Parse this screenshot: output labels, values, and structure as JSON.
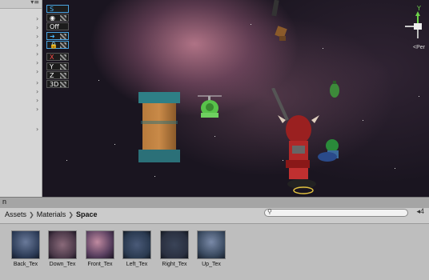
{
  "toolbar_buttons": [
    {
      "label": "S"
    },
    {
      "label": "◉"
    },
    {
      "label": "Off"
    },
    {
      "label": "➜"
    },
    {
      "label": "🔒"
    },
    {
      "label": "X"
    },
    {
      "label": "Y"
    },
    {
      "label": "Z"
    },
    {
      "label": "3D"
    }
  ],
  "gizmo": {
    "y_label": "Y",
    "persp_label": "<Per"
  },
  "project": {
    "tab_label": "n",
    "breadcrumb": [
      "Assets",
      "Materials",
      "Space"
    ],
    "search_placeholder": ""
  },
  "assets": [
    {
      "name": "Back_Tex",
      "color": "#2b3a55"
    },
    {
      "name": "Down_Tex",
      "color": "#4a3848"
    },
    {
      "name": "Front_Tex",
      "color": "#5a4060"
    },
    {
      "name": "Left_Tex",
      "color": "#2a3a50"
    },
    {
      "name": "Right_Tex",
      "color": "#2a3040"
    },
    {
      "name": "Up_Tex",
      "color": "#3a4a60"
    }
  ],
  "colors": {
    "accent_blue": "#4ab8ff",
    "axis_red": "#ff4a4a",
    "pillar_teal": "#2e7f86"
  }
}
